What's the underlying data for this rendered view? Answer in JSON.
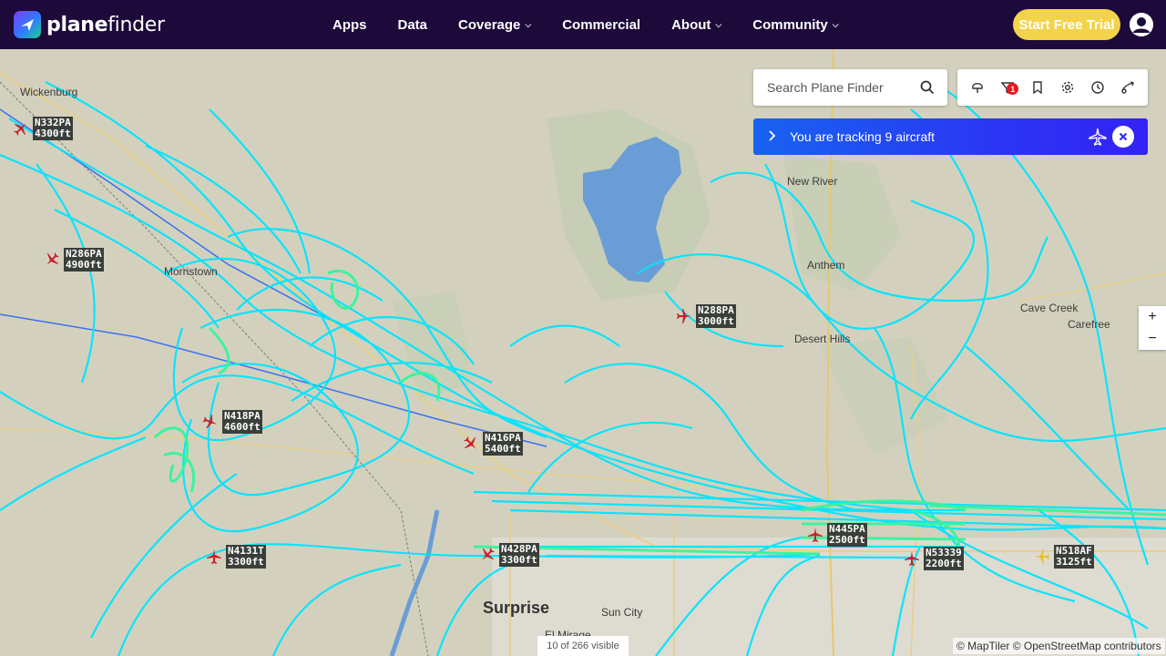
{
  "brand": {
    "name_bold": "plane",
    "name_light": "finder"
  },
  "nav": {
    "items": [
      {
        "label": "Apps",
        "dropdown": false
      },
      {
        "label": "Data",
        "dropdown": false
      },
      {
        "label": "Coverage",
        "dropdown": true
      },
      {
        "label": "Commercial",
        "dropdown": false
      },
      {
        "label": "About",
        "dropdown": true
      },
      {
        "label": "Community",
        "dropdown": true
      }
    ],
    "trial_label": "Start Free Trial"
  },
  "search": {
    "placeholder": "Search Plane Finder"
  },
  "toolbar": {
    "icons": [
      "weather-icon",
      "filter-icon",
      "bookmark-icon",
      "settings-icon",
      "history-icon",
      "ar-icon"
    ],
    "filter_badge": "1"
  },
  "tracking": {
    "text": "You are tracking 9 aircraft"
  },
  "zoom": {
    "in": "+",
    "out": "−"
  },
  "map": {
    "places": [
      {
        "name": "Wickenburg",
        "size": "normal"
      },
      {
        "name": "Morristown",
        "size": "normal"
      },
      {
        "name": "New River",
        "size": "normal"
      },
      {
        "name": "Anthem",
        "size": "normal"
      },
      {
        "name": "Desert Hills",
        "size": "normal"
      },
      {
        "name": "Cave Creek",
        "size": "normal"
      },
      {
        "name": "Carefree",
        "size": "normal"
      },
      {
        "name": "Surprise",
        "size": "big"
      },
      {
        "name": "Sun City",
        "size": "normal"
      },
      {
        "name": "El Mirage",
        "size": "normal"
      }
    ],
    "aircraft": [
      {
        "callsign": "N332PA",
        "altitude": "4300ft",
        "color": "#c8202a"
      },
      {
        "callsign": "N286PA",
        "altitude": "4900ft",
        "color": "#c8202a"
      },
      {
        "callsign": "N288PA",
        "altitude": "3000ft",
        "color": "#c8202a"
      },
      {
        "callsign": "N418PA",
        "altitude": "4600ft",
        "color": "#c8202a"
      },
      {
        "callsign": "N416PA",
        "altitude": "5400ft",
        "color": "#c8202a"
      },
      {
        "callsign": "N4131T",
        "altitude": "3300ft",
        "color": "#c8202a"
      },
      {
        "callsign": "N428PA",
        "altitude": "3300ft",
        "color": "#c8202a"
      },
      {
        "callsign": "N445PA",
        "altitude": "2500ft",
        "color": "#c8202a"
      },
      {
        "callsign": "N53339",
        "altitude": "2200ft",
        "color": "#c8202a"
      },
      {
        "callsign": "N518AF",
        "altitude": "3125ft",
        "color": "#e8c02a"
      }
    ]
  },
  "footer": {
    "visible_count": "10 of 266 visible",
    "attribution": "© MapTiler © OpenStreetMap contributors"
  },
  "colors": {
    "nav_bg": "#1d0a3a",
    "trial_bg": "#f3d34a",
    "track_cyan": "#00e5ff",
    "track_green": "#35f59a",
    "lake": "#6a9dd6"
  }
}
